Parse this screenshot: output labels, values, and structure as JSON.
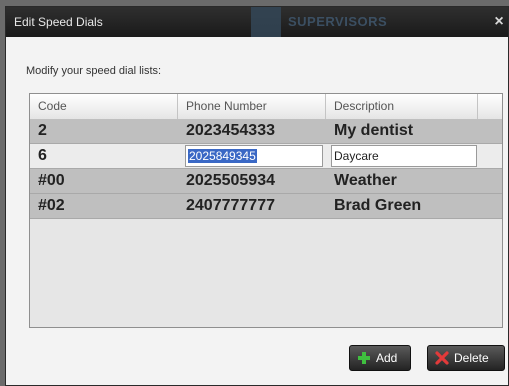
{
  "dialog": {
    "title": "Edit Speed Dials",
    "background_label": "SUPERVISORS",
    "close_glyph": "×",
    "prompt": "Modify your speed dial lists:"
  },
  "table": {
    "columns": [
      "Code",
      "Phone Number",
      "Description"
    ],
    "rows": [
      {
        "code": "2",
        "phone": "2023454333",
        "description": "My dentist"
      },
      {
        "code": "6",
        "phone": "2025849345",
        "description": "Daycare",
        "editing": true
      },
      {
        "code": "#00",
        "phone": "2025505934",
        "description": "Weather"
      },
      {
        "code": "#02",
        "phone": "2407777777",
        "description": "Brad Green"
      }
    ]
  },
  "buttons": {
    "add_label": "Add",
    "delete_label": "Delete"
  },
  "icons": {
    "add": "plus-icon",
    "delete": "x-icon",
    "close": "close-icon"
  },
  "colors": {
    "add_icon": "#3fbf3f",
    "delete_icon": "#e23a3a",
    "selection": "#3a68c5"
  }
}
